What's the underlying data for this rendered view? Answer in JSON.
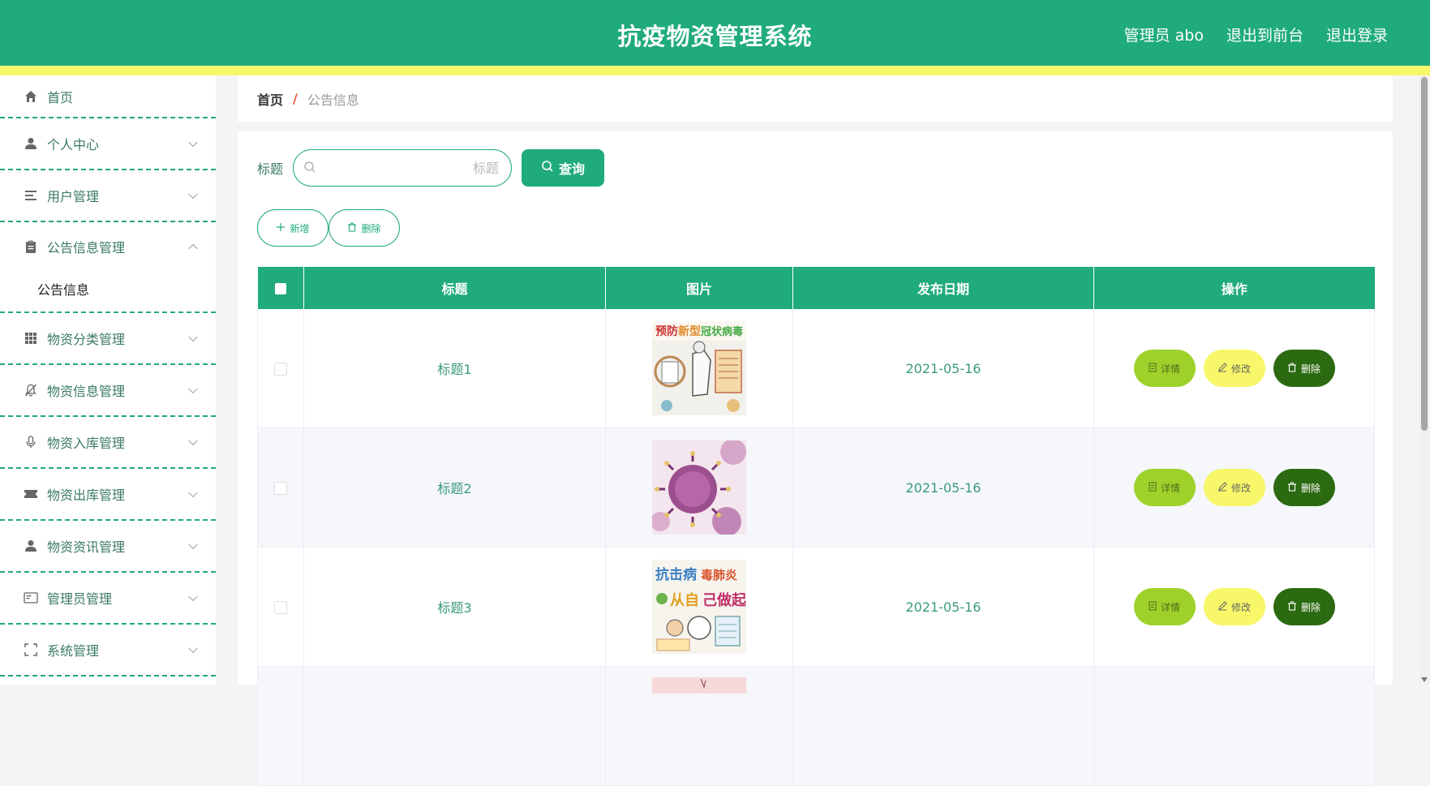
{
  "header": {
    "title": "抗疫物资管理系统",
    "nav": [
      "管理员 abo",
      "退出到前台",
      "退出登录"
    ]
  },
  "sidebar": {
    "items": [
      {
        "label": "首页",
        "icon": "home-icon"
      },
      {
        "label": "个人中心",
        "icon": "user-icon"
      },
      {
        "label": "用户管理",
        "icon": "list-icon"
      },
      {
        "label": "公告信息管理",
        "icon": "clipboard-icon",
        "expanded": true
      },
      {
        "label": "物资分类管理",
        "icon": "grid-icon"
      },
      {
        "label": "物资信息管理",
        "icon": "bell-off-icon"
      },
      {
        "label": "物资入库管理",
        "icon": "microphone-icon"
      },
      {
        "label": "物资出库管理",
        "icon": "ticket-icon"
      },
      {
        "label": "物资资讯管理",
        "icon": "user-icon"
      },
      {
        "label": "管理员管理",
        "icon": "id-card-icon"
      },
      {
        "label": "系统管理",
        "icon": "fullscreen-icon"
      }
    ],
    "subitem": "公告信息"
  },
  "breadcrumb": {
    "home": "首页",
    "separator": "/",
    "current": "公告信息"
  },
  "search": {
    "label": "标题",
    "placeholder": "标题",
    "value": "",
    "button": "查询"
  },
  "actions": {
    "add": "新增",
    "delete": "删除"
  },
  "table": {
    "columns": [
      "标题",
      "图片",
      "发布日期",
      "操作"
    ],
    "rows": [
      {
        "title": "标题1",
        "image": "poster-prevention",
        "date": "2021-05-16"
      },
      {
        "title": "标题2",
        "image": "virus-photo",
        "date": "2021-05-16"
      },
      {
        "title": "标题3",
        "image": "poster-anti-epidemic",
        "date": "2021-05-16"
      }
    ],
    "ops": {
      "detail": "详情",
      "edit": "修改",
      "delete": "删除"
    }
  },
  "colors": {
    "primary": "#1fab7a",
    "accent_yellow": "#f7f769",
    "detail_green": "#9ed22b",
    "delete_dark": "#2c6a12"
  }
}
